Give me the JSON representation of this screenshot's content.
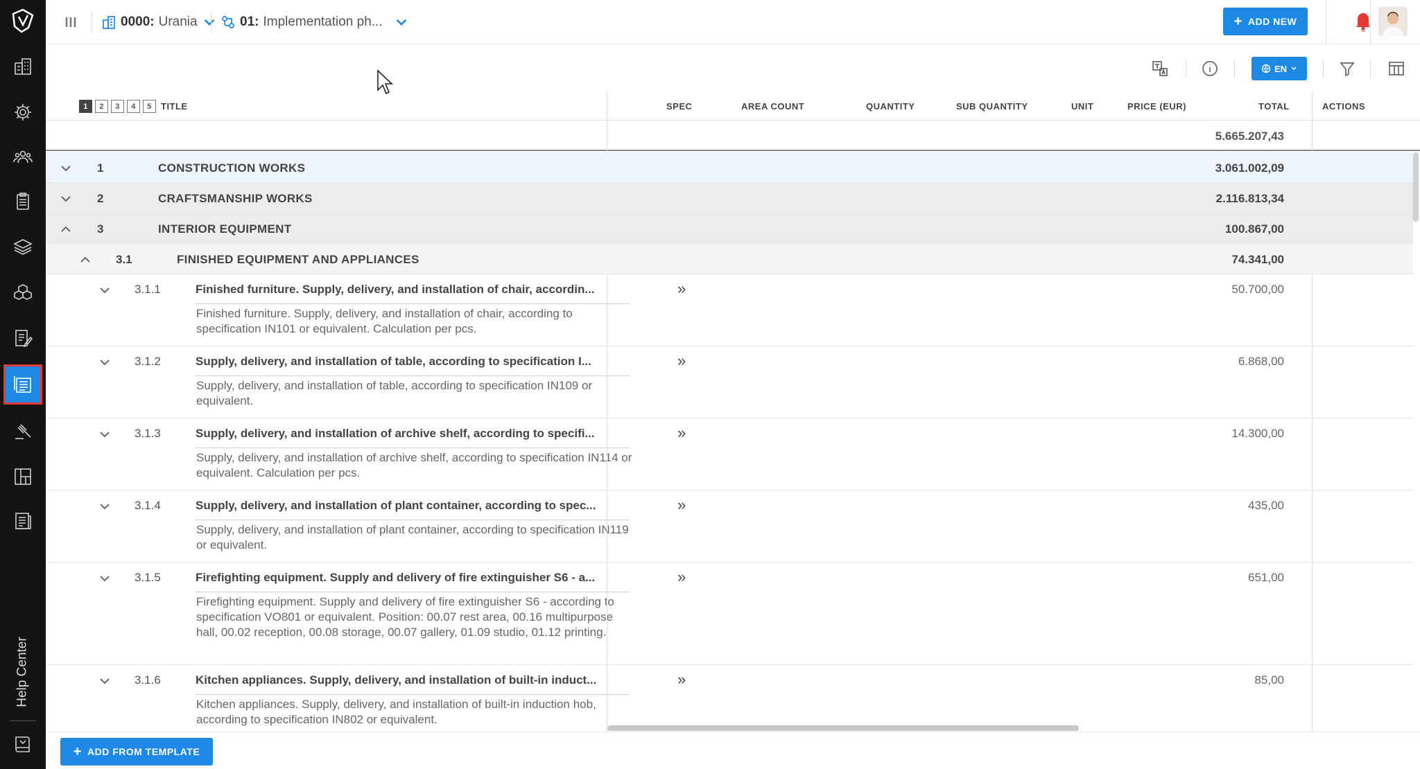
{
  "topbar": {
    "project_code": "0000:",
    "project_name": "Urania",
    "phase_code": "01:",
    "phase_name": "Implementation ph...",
    "add_new_label": "ADD NEW",
    "notification_count": "6"
  },
  "toolbar": {
    "language": "EN"
  },
  "table": {
    "levels": [
      "1",
      "2",
      "3",
      "4",
      "5"
    ],
    "active_level": "1",
    "columns": {
      "title": "TITLE",
      "spec": "SPEC",
      "area_count": "AREA COUNT",
      "quantity": "QUANTITY",
      "sub_quantity": "SUB QUANTITY",
      "unit": "UNIT",
      "price": "PRICE (EUR)",
      "total": "TOTAL",
      "actions": "ACTIONS"
    },
    "grand_total": "5.665.207,43",
    "groups": [
      {
        "num": "1",
        "title": "CONSTRUCTION WORKS",
        "total": "3.061.002,09"
      },
      {
        "num": "2",
        "title": "CRAFTSMANSHIP WORKS",
        "total": "2.116.813,34"
      },
      {
        "num": "3",
        "title": "INTERIOR EQUIPMENT",
        "total": "100.867,00"
      },
      {
        "num": "3.1",
        "title": "FINISHED EQUIPMENT AND APPLIANCES",
        "total": "74.341,00"
      }
    ],
    "items": [
      {
        "num": "3.1.1",
        "title": "Finished furniture. Supply, delivery, and installation of chair, accordin...",
        "desc": "Finished furniture. Supply, delivery, and installation of chair, according to specification IN101 or equivalent. Calculation per pcs.",
        "spec": "»",
        "total": "50.700,00"
      },
      {
        "num": "3.1.2",
        "title": "Supply, delivery, and installation of table, according to specification I...",
        "desc": "Supply, delivery, and installation of table, according to specification IN109 or equivalent.",
        "spec": "»",
        "total": "6.868,00"
      },
      {
        "num": "3.1.3",
        "title": "Supply, delivery, and installation of archive shelf, according to specifi...",
        "desc": "Supply, delivery, and installation of archive shelf, according to specification IN114 or equivalent. Calculation per pcs.",
        "spec": "»",
        "total": "14.300,00"
      },
      {
        "num": "3.1.4",
        "title": "Supply, delivery, and installation of plant container, according to spec...",
        "desc": "Supply, delivery, and installation of plant container, according to specification IN119 or equivalent.",
        "spec": "»",
        "total": "435,00"
      },
      {
        "num": "3.1.5",
        "title": "Firefighting equipment. Supply and delivery of fire extinguisher S6 - a...",
        "desc": "Firefighting equipment. Supply and delivery of fire extinguisher S6 - according to specification VO801 or equivalent. Position: 00.07 rest area, 00.16 multipurpose hall, 00.02 reception, 00.08 storage, 00.07 gallery, 01.09 studio, 01.12 printing.",
        "spec": "»",
        "total": "651,00"
      },
      {
        "num": "3.1.6",
        "title": "Kitchen appliances. Supply, delivery, and installation of built-in induct...",
        "desc": "Kitchen appliances. Supply, delivery, and installation of built-in induction hob, according to specification IN802 or equivalent.",
        "spec": "»",
        "total": "85,00"
      }
    ]
  },
  "sidebar": {
    "help_center": "Help Center"
  },
  "footer": {
    "add_from_template_label": "ADD FROM TEMPLATE"
  },
  "colors": {
    "accent": "#1e88e5",
    "rail_bg": "#141414",
    "active_outline": "#e53935",
    "group_row_bg": "#ececec",
    "group_row_highlight": "#eef4fb"
  },
  "icons": [
    "app-logo-icon",
    "buildings-icon",
    "settings-gear-icon",
    "team-icon",
    "clipboard-icon",
    "layers-icon",
    "cubes-icon",
    "document-edit-icon",
    "bill-of-quantities-icon",
    "gavel-icon",
    "layout-icon",
    "report-icon",
    "book-icon"
  ]
}
